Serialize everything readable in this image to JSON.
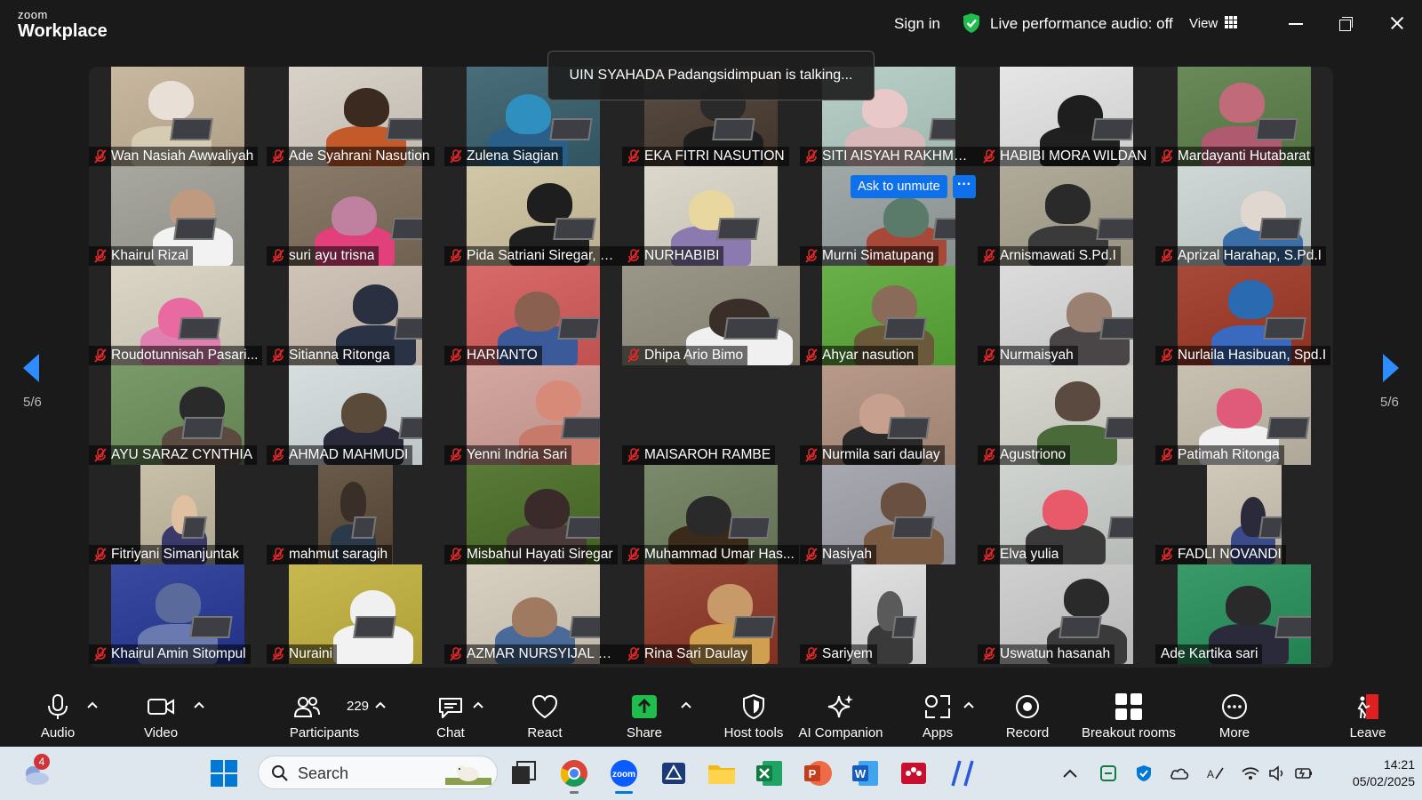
{
  "window": {
    "app_logo_top": "zoom",
    "app_logo_bottom": "Workplace",
    "sign_in": "Sign in",
    "live_audio": "Live performance audio: off",
    "view": "View"
  },
  "talking_banner": "UIN SYAHADA Padangsidimpuan is talking...",
  "ask_to_unmute": "Ask to unmute",
  "more_dots": "···",
  "pagination": {
    "left": "5/6",
    "right": "5/6"
  },
  "participants": [
    {
      "name": "Wan Nasiah Awwaliyah",
      "bg": "#c9b8a0",
      "skin": "#e8e0d6",
      "cloth": "#d6cbb3"
    },
    {
      "name": "Ade Syahrani Nasution",
      "bg": "#d8d2c8",
      "skin": "#3a2a20",
      "cloth": "#c45a2a"
    },
    {
      "name": "Zulena Siagian",
      "bg": "#4a6d7a",
      "skin": "#2f8fbf",
      "cloth": "#2a5f8a"
    },
    {
      "name": "EKA FITRI NASUTION",
      "bg": "#5a4e44",
      "skin": "#2a2a2a",
      "cloth": "#1e1e1e"
    },
    {
      "name": "SITI AISYAH RAKHMA...",
      "bg": "#b8d0c8",
      "skin": "#e8c8c8",
      "cloth": "#d8b8b8"
    },
    {
      "name": "HABIBI MORA WILDAN",
      "bg": "#e6e6e6",
      "skin": "#1e1e1e",
      "cloth": "#202020"
    },
    {
      "name": "Mardayanti Hutabarat",
      "bg": "#6a8a5a",
      "skin": "#c06a7a",
      "cloth": "#b05a70"
    },
    {
      "name": "Khairul Rizal",
      "bg": "#a8a8a0",
      "skin": "#c09a80",
      "cloth": "#f2f2f2"
    },
    {
      "name": "suri ayu trisna",
      "bg": "#8a7a6a",
      "skin": "#c080a0",
      "cloth": "#e2407a"
    },
    {
      "name": "Pida Satriani Siregar, S...",
      "bg": "#d2c8a8",
      "skin": "#1e1e1e",
      "cloth": "#202020"
    },
    {
      "name": "NURHABIBI",
      "bg": "#dcd8cc",
      "skin": "#e8d8a0",
      "cloth": "#8a7ab0"
    },
    {
      "name": "Murni Simatupang",
      "bg": "#a0a8a8",
      "skin": "#5a7a6a",
      "cloth": "#a84838"
    },
    {
      "name": "Arnismawati S.Pd.I",
      "bg": "#b0aa98",
      "skin": "#2a2a2a",
      "cloth": "#3a3a3a"
    },
    {
      "name": "Aprizal Harahap, S.Pd.I",
      "bg": "#cfd8d6",
      "skin": "#e0d8d0",
      "cloth": "#3a6ea8"
    },
    {
      "name": "Roudotunnisah Pasari...",
      "bg": "#dcd6c6",
      "skin": "#e86aa0",
      "cloth": "#e080b0"
    },
    {
      "name": "Sitianna Ritonga",
      "bg": "#d0c4b8",
      "skin": "#2a3040",
      "cloth": "#2a3246"
    },
    {
      "name": "HARIANTO",
      "bg": "#d86a6a",
      "skin": "#8a6050",
      "cloth": "#3a5a9a"
    },
    {
      "name": "Dhipa Ario Bimo",
      "bg": "#9a9688",
      "skin": "#3a2e28",
      "cloth": "#f0f0f0"
    },
    {
      "name": "Ahyar nasution",
      "bg": "#6ab04a",
      "skin": "#8a6a58",
      "cloth": "#6a5a3a"
    },
    {
      "name": "Nurmaisyah",
      "bg": "#dcdcdc",
      "skin": "#9a8070",
      "cloth": "#4a4648"
    },
    {
      "name": "Nurlaila Hasibuan, Spd.I",
      "bg": "#a84a3a",
      "skin": "#2a6ab0",
      "cloth": "#3a6abf"
    },
    {
      "name": "AYU SARAZ CYNTHIA",
      "bg": "#7a9a6a",
      "skin": "#2a2a2a",
      "cloth": "#5a4a40"
    },
    {
      "name": "AHMAD MAHMUDI",
      "bg": "#d6dee0",
      "skin": "#5a4a3a",
      "cloth": "#2a2a3a"
    },
    {
      "name": "Yenni Indria Sari",
      "bg": "#d4a8a0",
      "skin": "#d88a78",
      "cloth": "#c87a6a"
    },
    {
      "name": "MAISAROH RAMBE",
      "bg": "#242424",
      "skin": "#242424",
      "cloth": "#242424"
    },
    {
      "name": "Nurmila sari daulay",
      "bg": "#b89a8a",
      "skin": "#c8a090",
      "cloth": "#2a2a2a"
    },
    {
      "name": "Agustriono",
      "bg": "#d8d8d0",
      "skin": "#5a4a40",
      "cloth": "#4a6a3a"
    },
    {
      "name": "Patimah Ritonga",
      "bg": "#c8c0b0",
      "skin": "#e05a7a",
      "cloth": "#f0f0f0"
    },
    {
      "name": "Fitriyani Simanjuntak",
      "bg": "#c8c0a8",
      "skin": "#e0c0a0",
      "cloth": "#3a3a6a"
    },
    {
      "name": "mahmut saragih",
      "bg": "#6a5a4a",
      "skin": "#3a2e28",
      "cloth": "#2a3a4a"
    },
    {
      "name": "Misbahul Hayati Siregar",
      "bg": "#5a7a3a",
      "skin": "#3a2a2a",
      "cloth": "#4a3a3a"
    },
    {
      "name": "Muhammad Umar Has...",
      "bg": "#7a8a6a",
      "skin": "#2a2a2a",
      "cloth": "#3a2a1a"
    },
    {
      "name": "Nasiyah",
      "bg": "#a8a8b0",
      "skin": "#6a5040",
      "cloth": "#7a5a40"
    },
    {
      "name": "Elva yulia",
      "bg": "#cfd4d0",
      "skin": "#e85a6a",
      "cloth": "#3a3a3a"
    },
    {
      "name": "FADLI NOVANDI",
      "bg": "#d0c8b8",
      "skin": "#2a2a3a",
      "cloth": "#3a4a8a"
    },
    {
      "name": "Khairul Amin Sitompul",
      "bg": "#3a4aa0",
      "skin": "#5a6a9a",
      "cloth": "#6a7ab0"
    },
    {
      "name": "Nuraini",
      "bg": "#c8b850",
      "skin": "#f0f0f0",
      "cloth": "#f2f2f2"
    },
    {
      "name": "AZMAR NURSYIJAL HA...",
      "bg": "#d8d0c0",
      "skin": "#a07a60",
      "cloth": "#4a6a9a"
    },
    {
      "name": "Rina Sari Daulay",
      "bg": "#9a4a3a",
      "skin": "#c89a6a",
      "cloth": "#d0a050"
    },
    {
      "name": "Sariyem",
      "bg": "#e0e0e0",
      "skin": "#5a5a5a",
      "cloth": "#3a3a3a"
    },
    {
      "name": "Uswatun hasanah",
      "bg": "#d0d0d0",
      "skin": "#2a2a2a",
      "cloth": "#3a3a3a"
    },
    {
      "name": "Ade Kartika sari",
      "bg": "#3a9a6a",
      "skin": "#2a2a2a",
      "cloth": "#2a2a3a"
    }
  ],
  "toolbar": {
    "audio": "Audio",
    "video": "Video",
    "participants": "Participants",
    "participants_count": "229",
    "chat": "Chat",
    "react": "React",
    "share": "Share",
    "host_tools": "Host tools",
    "ai_companion": "AI Companion",
    "apps": "Apps",
    "record": "Record",
    "breakout_rooms": "Breakout rooms",
    "more": "More",
    "leave": "Leave"
  },
  "taskbar": {
    "weather_badge": "4",
    "search_placeholder": "Search",
    "time": "14:21",
    "date": "05/02/2025"
  },
  "colors": {
    "accent_blue": "#0e71eb",
    "share_green": "#1fbe4c",
    "mute_red": "#e02828",
    "leave_red": "#e02020",
    "shield_green": "#1fbe4c"
  }
}
